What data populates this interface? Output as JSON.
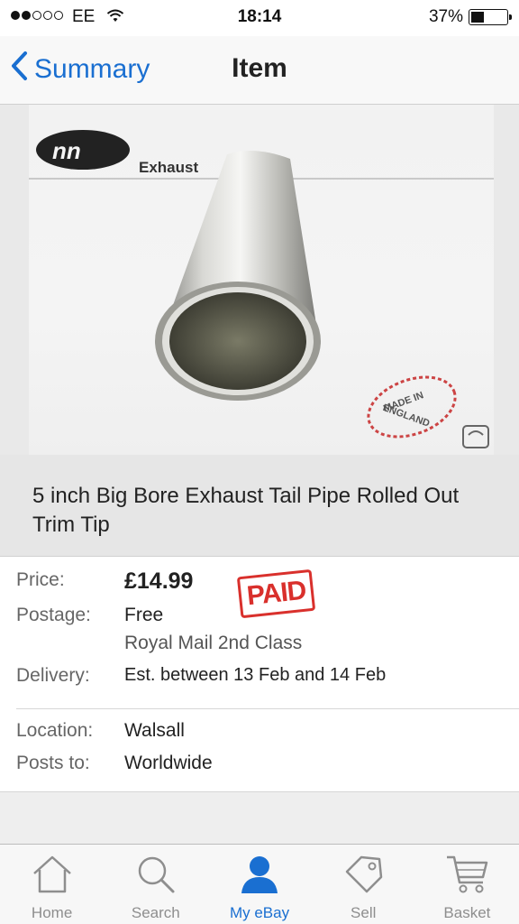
{
  "status_bar": {
    "carrier": "EE",
    "time": "18:14",
    "battery_percent": "37%",
    "battery_level": 0.37,
    "signal_bars_filled": 2,
    "signal_bars_total": 5
  },
  "nav": {
    "back_label": "Summary",
    "title": "Item"
  },
  "image": {
    "brand_caption": "Exhaust",
    "stamp_text": "MADE IN ENGLAND"
  },
  "item": {
    "title": "5 inch Big Bore Exhaust Tail Pipe Rolled Out Trim Tip"
  },
  "details": {
    "price_label": "Price:",
    "price_value": "£14.99",
    "paid_stamp": "PAID",
    "postage_label": "Postage:",
    "postage_value": "Free",
    "postage_service": "Royal Mail 2nd Class",
    "delivery_label": "Delivery:",
    "delivery_value": "Est. between 13 Feb and 14 Feb",
    "location_label": "Location:",
    "location_value": "Walsall",
    "posts_to_label": "Posts to:",
    "posts_to_value": "Worldwide"
  },
  "tabs": [
    {
      "label": "Home",
      "icon": "home-icon",
      "active": false
    },
    {
      "label": "Search",
      "icon": "search-icon",
      "active": false
    },
    {
      "label": "My eBay",
      "icon": "person-icon",
      "active": true
    },
    {
      "label": "Sell",
      "icon": "tag-icon",
      "active": false
    },
    {
      "label": "Basket",
      "icon": "cart-icon",
      "active": false
    }
  ],
  "colors": {
    "accent": "#1a6fd1",
    "paid_red": "#d9302c",
    "inactive_tab": "#8e8e8e"
  }
}
